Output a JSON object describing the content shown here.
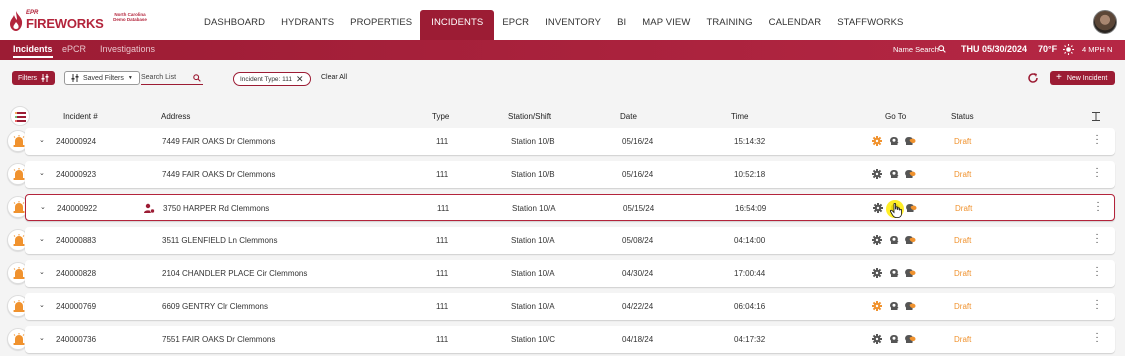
{
  "app": {
    "brand_prefix": "EPR",
    "brand_name": "FIREWORKS",
    "org_name": "North Carolina Demo Database"
  },
  "nav": {
    "items": [
      {
        "label": "DASHBOARD"
      },
      {
        "label": "HYDRANTS"
      },
      {
        "label": "PROPERTIES"
      },
      {
        "label": "INCIDENTS",
        "active": true
      },
      {
        "label": "EPCR"
      },
      {
        "label": "INVENTORY"
      },
      {
        "label": "BI"
      },
      {
        "label": "MAP VIEW"
      },
      {
        "label": "TRAINING"
      },
      {
        "label": "CALENDAR"
      },
      {
        "label": "STAFFWORKS"
      }
    ]
  },
  "subnav": {
    "tabs": [
      {
        "label": "Incidents",
        "active": true
      },
      {
        "label": "ePCR"
      },
      {
        "label": "Investigations"
      }
    ],
    "name_search_label": "Name Search",
    "date": "THU  05/30/2024",
    "temperature": "70°F",
    "wind": "4 MPH N"
  },
  "toolbar": {
    "filters_label": "Filters",
    "saved_filters_label": "Saved Filters",
    "search_placeholder": "Search List",
    "chip_label": "Incident Type: 111",
    "clear_all_label": "Clear All",
    "new_incident_label": "New Incident"
  },
  "table": {
    "headers": {
      "incident": "Incident #",
      "address": "Address",
      "type": "Type",
      "station": "Station/Shift",
      "date": "Date",
      "time": "Time",
      "goto": "Go To",
      "status": "Status"
    },
    "rows": [
      {
        "incident": "240000924",
        "address": "7449 FAIR OAKS Dr Clemmons",
        "type": "111",
        "station": "Station 10/B",
        "date": "05/16/24",
        "time": "15:14:32",
        "status": "Draft",
        "gear_orange": true
      },
      {
        "incident": "240000923",
        "address": "7449 FAIR OAKS Dr Clemmons",
        "type": "111",
        "station": "Station 10/B",
        "date": "05/16/24",
        "time": "10:52:18",
        "status": "Draft",
        "gear_orange": false
      },
      {
        "incident": "240000922",
        "address": "3750 HARPER Rd Clemmons",
        "type": "111",
        "station": "Station 10/A",
        "date": "05/15/24",
        "time": "16:54:09",
        "status": "Draft",
        "gear_orange": false,
        "selected": true,
        "has_person": true
      },
      {
        "incident": "240000883",
        "address": "3511 GLENFIELD Ln Clemmons",
        "type": "111",
        "station": "Station 10/A",
        "date": "05/08/24",
        "time": "04:14:00",
        "status": "Draft",
        "gear_orange": false
      },
      {
        "incident": "240000828",
        "address": "2104 CHANDLER PLACE Cir Clemmons",
        "type": "111",
        "station": "Station 10/A",
        "date": "04/30/24",
        "time": "17:00:44",
        "status": "Draft",
        "gear_orange": false
      },
      {
        "incident": "240000769",
        "address": "6609 GENTRY Clr Clemmons",
        "type": "111",
        "station": "Station 10/A",
        "date": "04/22/24",
        "time": "06:04:16",
        "status": "Draft",
        "gear_orange": true
      },
      {
        "incident": "240000736",
        "address": "7551 FAIR OAKS Dr Clemmons",
        "type": "111",
        "station": "Station 10/C",
        "date": "04/18/24",
        "time": "04:17:32",
        "status": "Draft",
        "gear_orange": false
      }
    ]
  },
  "colors": {
    "brand": "#9c1c34",
    "status_draft": "#f0922e",
    "bell": "#f0922e"
  }
}
